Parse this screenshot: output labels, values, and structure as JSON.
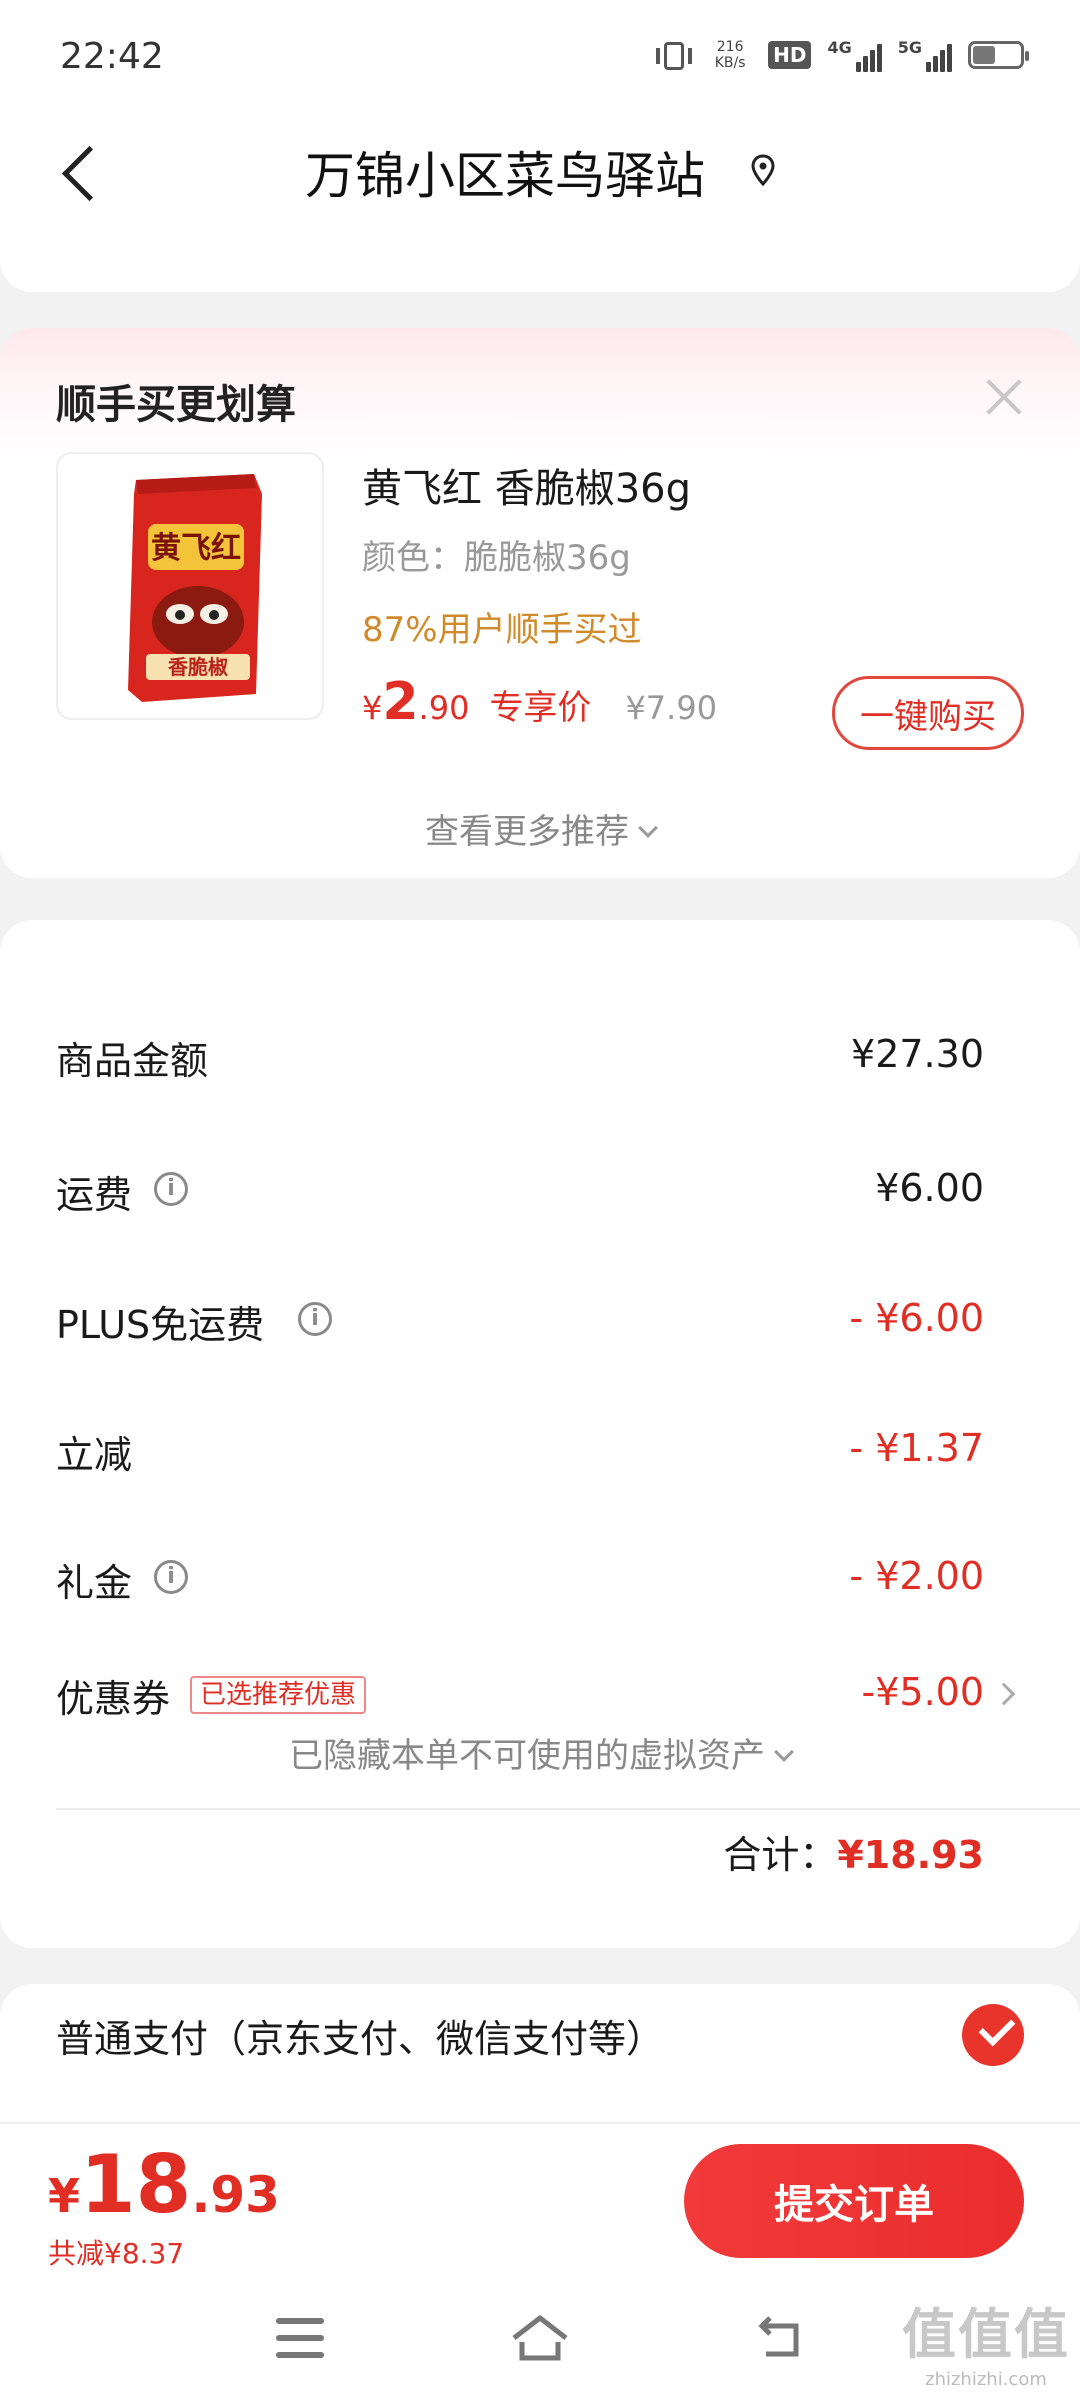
{
  "status_bar": {
    "time": "22:42",
    "net_speed_value": "216",
    "net_speed_unit": "KB/s",
    "hd_label": "HD",
    "sim1_type": "4G",
    "sim2_type": "5G"
  },
  "header": {
    "title": "万锦小区菜鸟驿站"
  },
  "upsell": {
    "title": "顺手买更划算",
    "product": {
      "name": "黄飞红 香脆椒36g",
      "spec": "颜色：脆脆椒36g",
      "stat": "87%用户顺手买过",
      "price_symbol": "¥",
      "price_integer": "2",
      "price_decimal": ".90",
      "price_tag": "专享价",
      "original_price": "¥7.90",
      "buy_button": "一键购买",
      "package_brand": "黄飞红",
      "package_flavor": "香脆椒"
    },
    "more_link": "查看更多推荐"
  },
  "amounts": {
    "rows": [
      {
        "label": "商品金额",
        "value": "¥27.30"
      },
      {
        "label": "运费",
        "value": "¥6.00"
      },
      {
        "label": "PLUS免运费",
        "value": "- ¥6.00"
      },
      {
        "label": "立减",
        "value": "- ¥1.37"
      },
      {
        "label": "礼金",
        "value": "- ¥2.00"
      },
      {
        "label": "优惠券",
        "value": "-¥5.00",
        "tag": "已选推荐优惠"
      }
    ],
    "hidden_assets": "已隐藏本单不可使用的虚拟资产",
    "total_label": "合计：",
    "total_value": "¥18.93"
  },
  "payment": {
    "method": "普通支付（京东支付、微信支付等）",
    "selected": true
  },
  "bottom_bar": {
    "price_symbol": "¥",
    "price_integer": "18",
    "price_decimal": ".93",
    "saved_text": "共减¥8.37",
    "submit_button": "提交订单"
  },
  "watermark": {
    "text": "值值值",
    "url": "zhizhizhi.com"
  },
  "colors": {
    "accent_red": "#e02e24",
    "stat_orange": "#d08a2a",
    "background": "#f2f2f2"
  }
}
